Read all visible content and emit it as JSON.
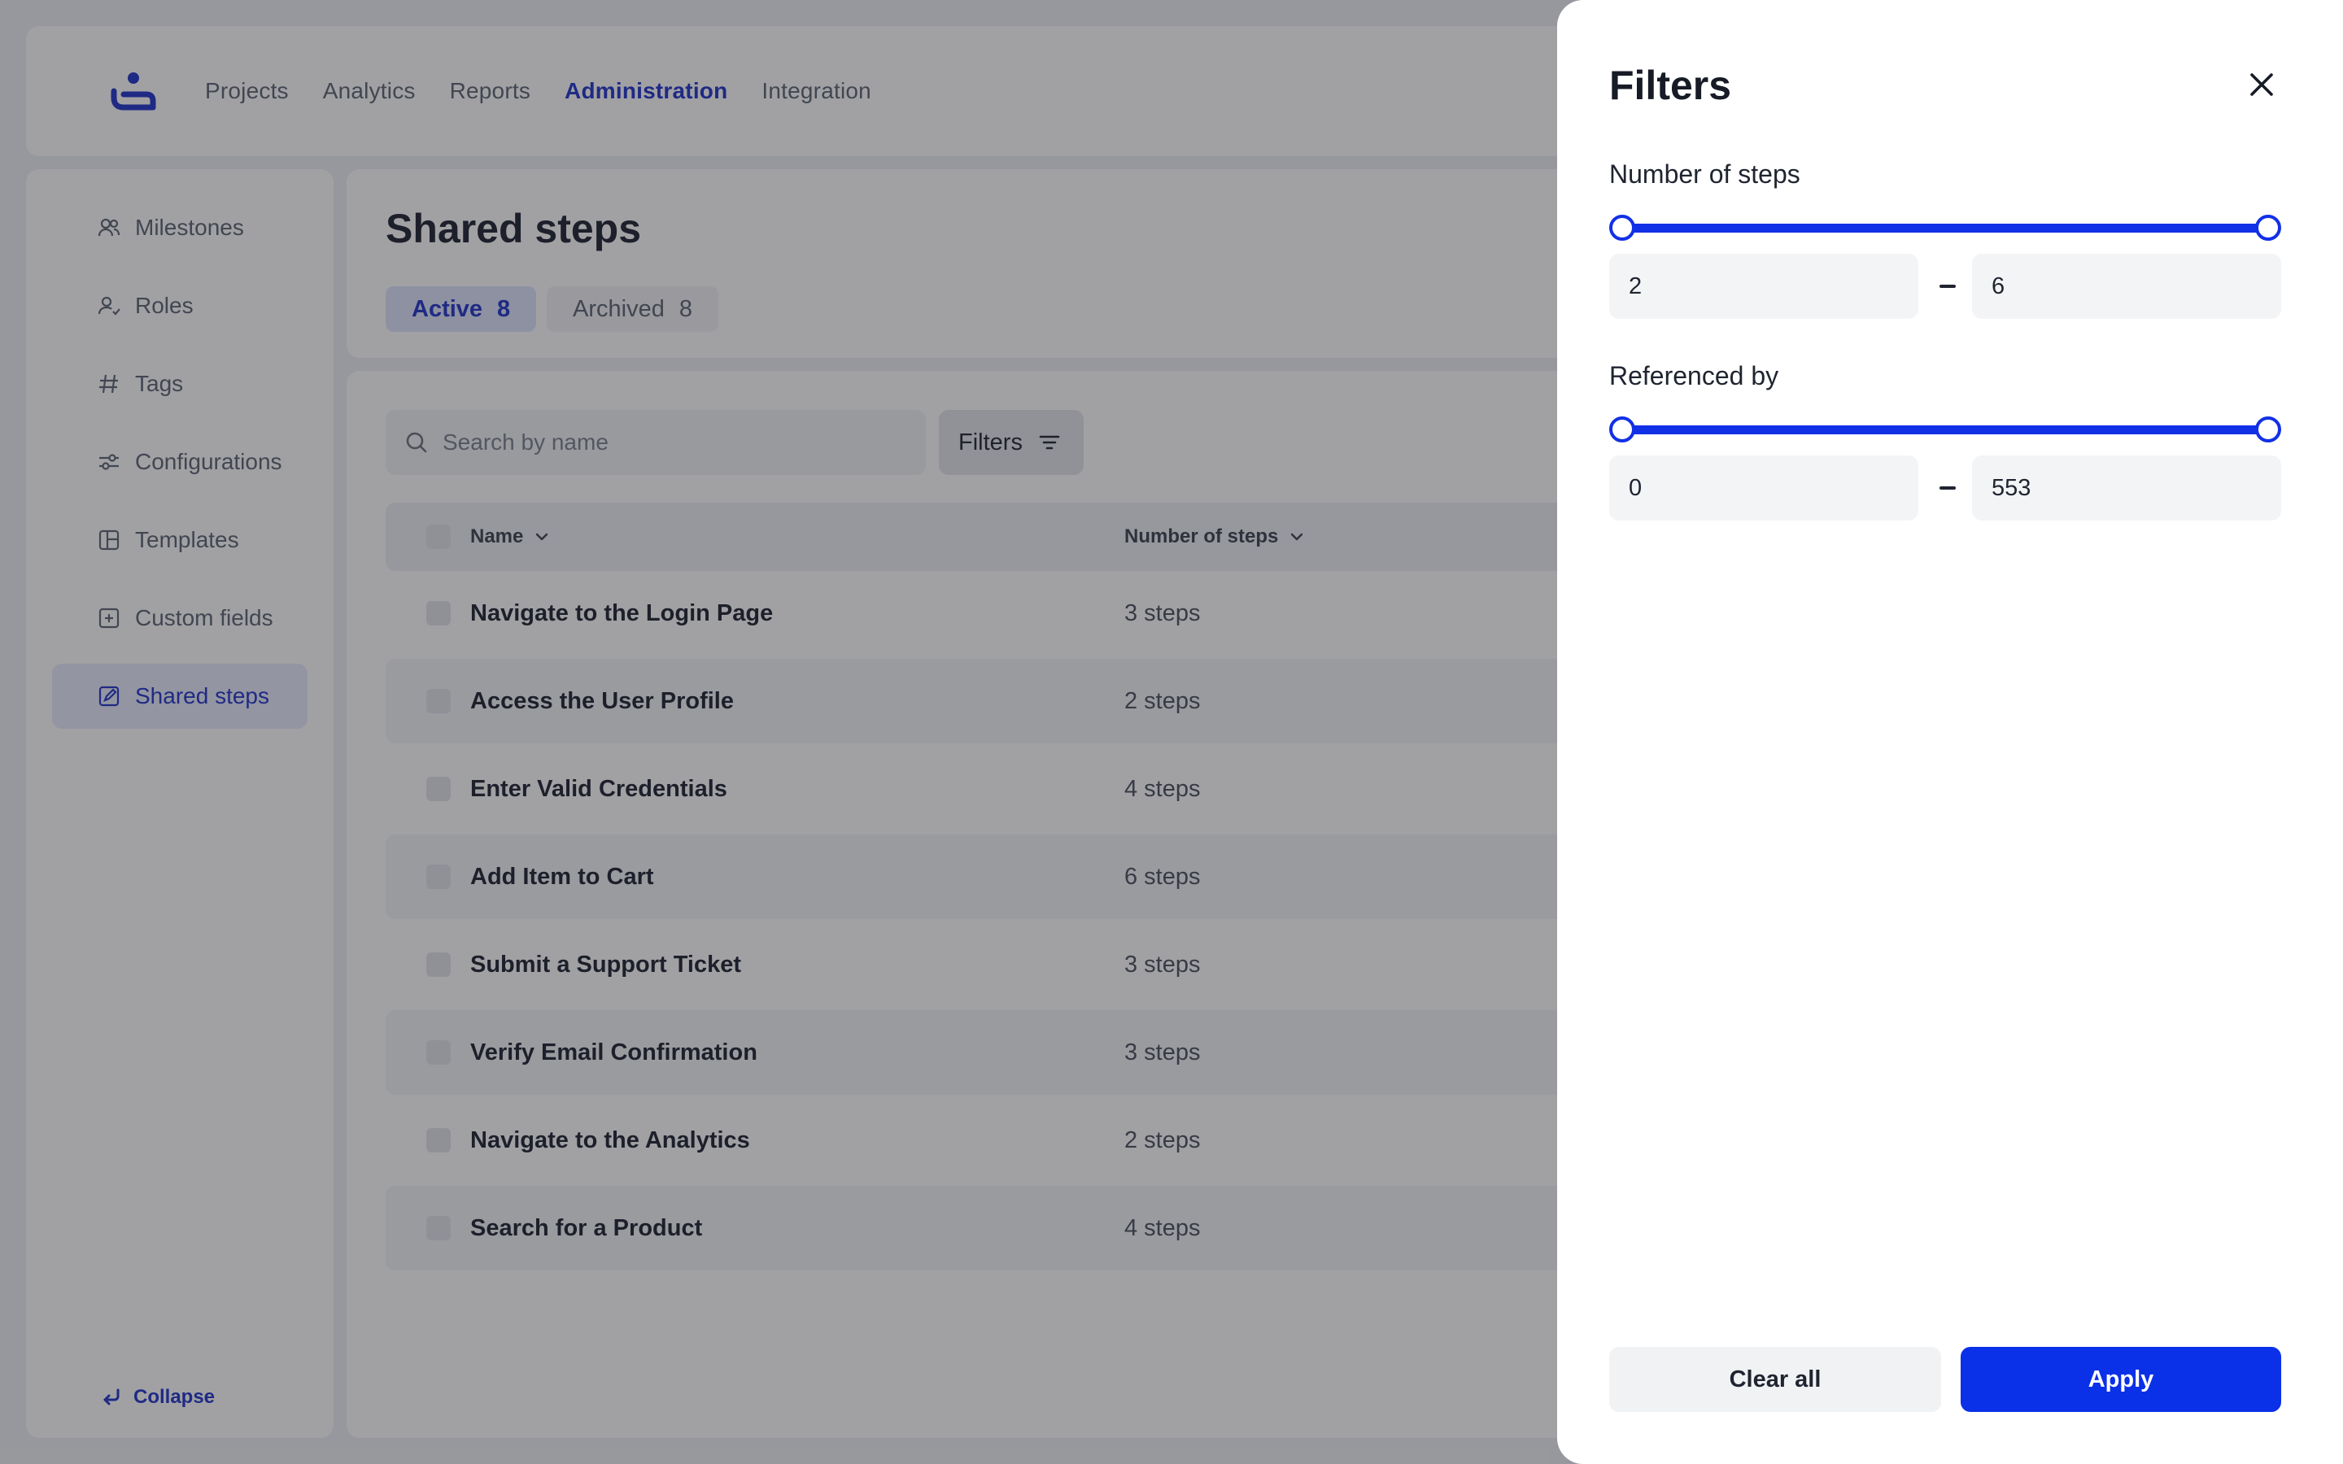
{
  "colors": {
    "accent": "#1f33c8",
    "apply": "#0a30e8",
    "slider": "#1230e6"
  },
  "topnav": {
    "logo_icon": "lifebuoy-person-icon",
    "items": [
      {
        "label": "Projects",
        "active": false
      },
      {
        "label": "Analytics",
        "active": false
      },
      {
        "label": "Reports",
        "active": false
      },
      {
        "label": "Administration",
        "active": true
      },
      {
        "label": "Integration",
        "active": false
      }
    ]
  },
  "sidebar": {
    "items": [
      {
        "label": "Milestones",
        "icon": "users-icon"
      },
      {
        "label": "Roles",
        "icon": "user-role-icon"
      },
      {
        "label": "Tags",
        "icon": "hash-icon"
      },
      {
        "label": "Configurations",
        "icon": "sliders-icon"
      },
      {
        "label": "Templates",
        "icon": "layout-icon"
      },
      {
        "label": "Custom fields",
        "icon": "plus-square-icon"
      },
      {
        "label": "Shared steps",
        "icon": "edit-square-icon",
        "active": true
      }
    ],
    "collapse_label": "Collapse"
  },
  "page": {
    "title": "Shared steps",
    "tabs": [
      {
        "label": "Active",
        "count": "8",
        "active": true
      },
      {
        "label": "Archived",
        "count": "8",
        "active": false
      }
    ]
  },
  "toolbar": {
    "search_placeholder": "Search by name",
    "filters_label": "Filters"
  },
  "table": {
    "columns": [
      "Name",
      "Number of steps"
    ],
    "rows": [
      {
        "name": "Navigate to the Login Page",
        "steps": "3 steps"
      },
      {
        "name": "Access the User Profile",
        "steps": "2 steps"
      },
      {
        "name": "Enter Valid Credentials",
        "steps": "4 steps"
      },
      {
        "name": "Add Item to Cart",
        "steps": "6 steps"
      },
      {
        "name": "Submit a Support Ticket",
        "steps": "3 steps"
      },
      {
        "name": "Verify Email Confirmation",
        "steps": "3 steps"
      },
      {
        "name": "Navigate to the Analytics",
        "steps": "2 steps"
      },
      {
        "name": "Search for a Product",
        "steps": "4 steps"
      }
    ]
  },
  "drawer": {
    "title": "Filters",
    "steps_filter": {
      "label": "Number of steps",
      "min": "2",
      "max": "6",
      "separator": "–"
    },
    "referenced_filter": {
      "label": "Referenced by",
      "min": "0",
      "max": "553",
      "separator": "–"
    },
    "clear_label": "Clear all",
    "apply_label": "Apply"
  }
}
